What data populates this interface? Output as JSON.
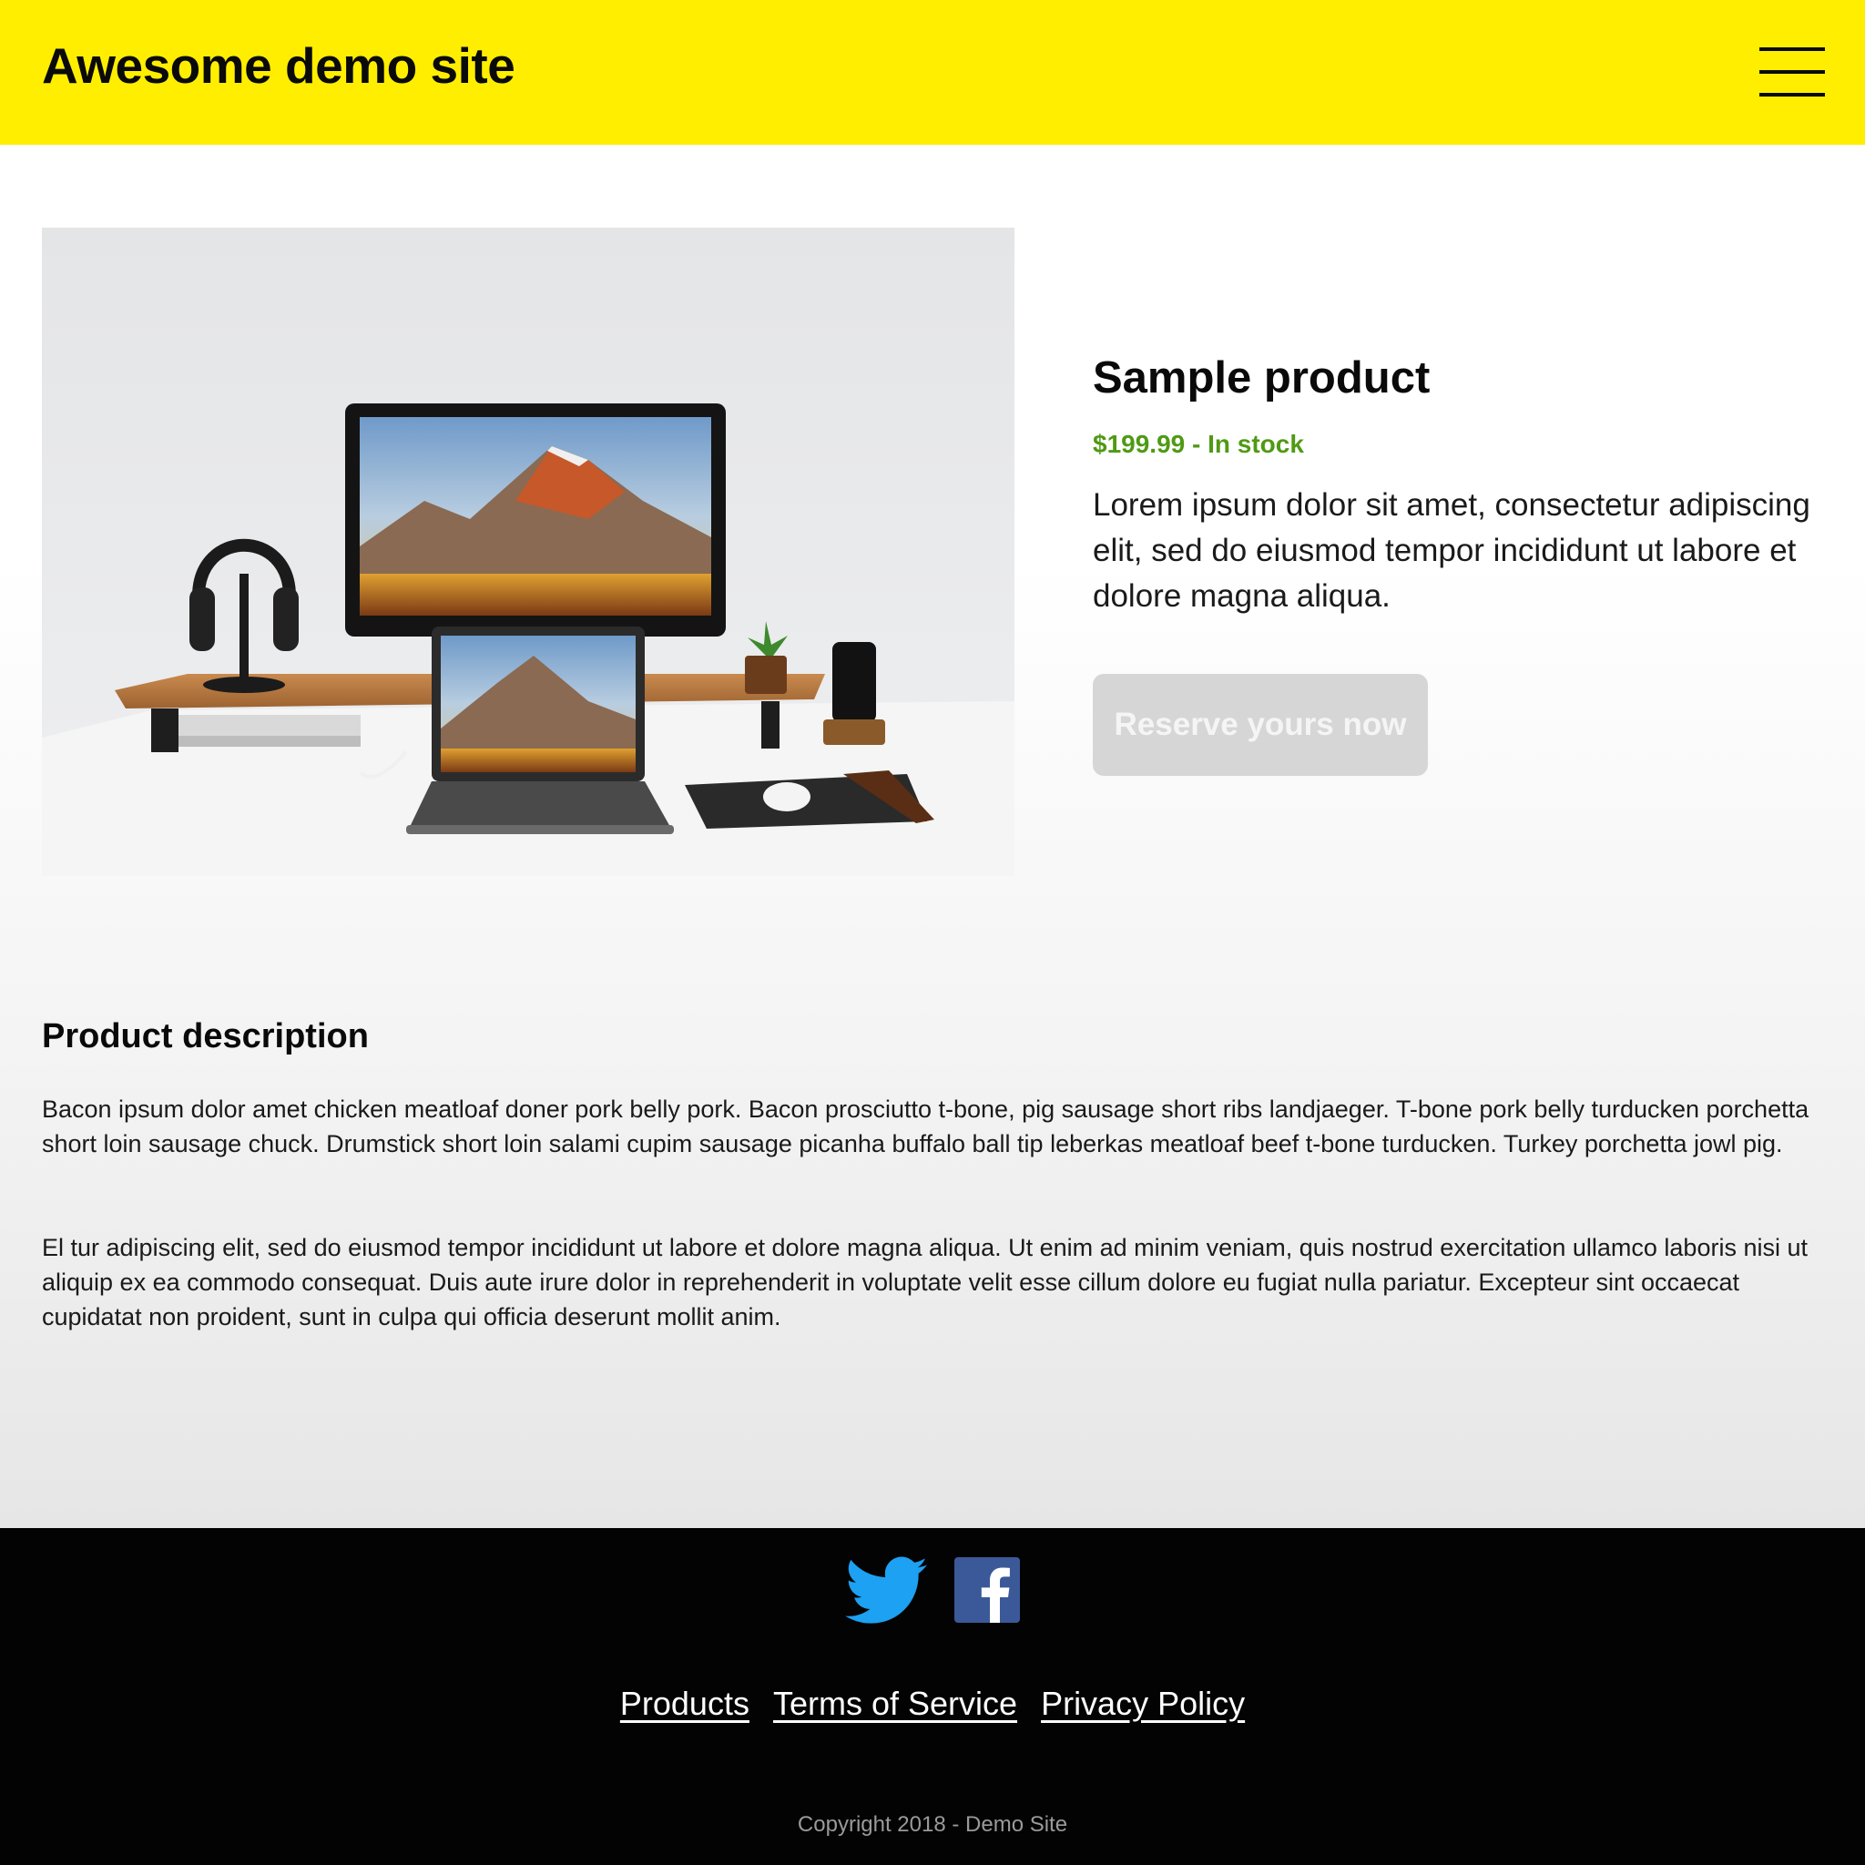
{
  "header": {
    "site_title": "Awesome demo site",
    "menu_icon": "hamburger-menu-icon"
  },
  "product": {
    "image_alt": "Desk setup with monitor, laptop, headphones, phone and plant",
    "title": "Sample product",
    "price_status": "$199.99 - In stock",
    "summary": "Lorem ipsum dolor sit amet, consectetur adipiscing elit, sed do eiusmod tempor incididunt ut labore et dolore magna aliqua.",
    "cta_label": "Reserve yours now"
  },
  "description": {
    "heading": "Product description",
    "paragraphs": [
      "Bacon ipsum dolor amet chicken meatloaf doner pork belly pork. Bacon prosciutto t-bone, pig sausage short ribs landjaeger. T-bone pork belly turducken porchetta short loin sausage chuck. Drumstick short loin salami cupim sausage picanha buffalo ball tip leberkas meatloaf beef t-bone turducken. Turkey porchetta jowl pig.",
      "El tur adipiscing elit, sed do eiusmod tempor incididunt ut labore et dolore magna aliqua. Ut enim ad minim veniam, quis nostrud exercitation ullamco laboris nisi ut aliquip ex ea commodo consequat. Duis aute irure dolor in reprehenderit in voluptate velit esse cillum dolore eu fugiat nulla pariatur. Excepteur sint occaecat cupidatat non proident, sunt in culpa qui officia deserunt mollit anim."
    ]
  },
  "footer": {
    "social": [
      "twitter-icon",
      "facebook-icon"
    ],
    "links": [
      "Products",
      "Terms of Service",
      "Privacy Policy"
    ],
    "copyright": "Copyright 2018 - Demo Site"
  },
  "colors": {
    "header_bg": "#ffee00",
    "price": "#4f9a14",
    "button_bg": "#d6d6d6",
    "footer_bg": "#030303",
    "twitter": "#1da1f2",
    "facebook": "#3b5998"
  }
}
